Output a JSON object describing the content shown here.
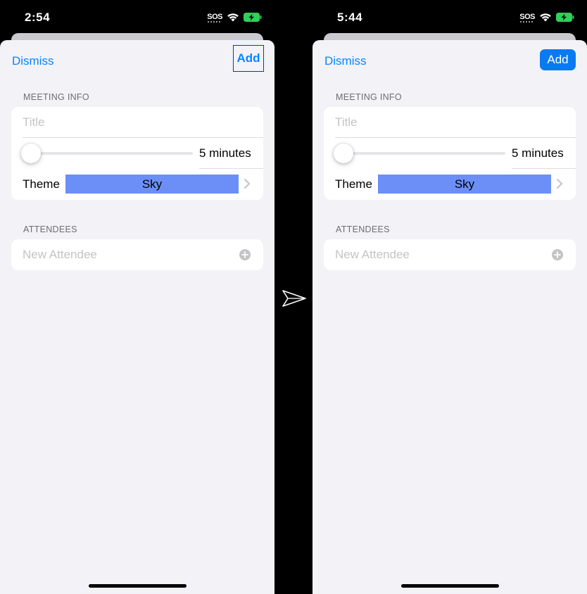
{
  "screens": [
    {
      "status_time": "2:54",
      "sos": "SOS",
      "nav": {
        "dismiss_label": "Dismiss",
        "add_label": "Add"
      },
      "meeting_info": {
        "header": "MEETING INFO",
        "title_placeholder": "Title",
        "slider_value": 0,
        "minutes_label": "5 minutes",
        "theme_label": "Theme",
        "theme_value": "Sky"
      },
      "attendees": {
        "header": "ATTENDEES",
        "placeholder": "New Attendee"
      }
    },
    {
      "status_time": "5:44",
      "sos": "SOS",
      "nav": {
        "dismiss_label": "Dismiss",
        "add_label": "Add"
      },
      "meeting_info": {
        "header": "MEETING INFO",
        "title_placeholder": "Title",
        "slider_value": 0,
        "minutes_label": "5 minutes",
        "theme_label": "Theme",
        "theme_value": "Sky"
      },
      "attendees": {
        "header": "ATTENDEES",
        "placeholder": "New Attendee"
      }
    }
  ],
  "icons": {
    "signal": "sos-signal-icon",
    "wifi": "wifi-icon",
    "battery": "battery-charging-icon",
    "chevron": "chevron-right-icon",
    "add_attendee": "plus-circle-icon",
    "transition": "arrow-right-icon"
  },
  "colors": {
    "accent": "#0a84ff",
    "add_button_filled": "#0a7af0",
    "add_button_highlight_border": "#1a33a6",
    "theme_sky": "#6b8ff7",
    "background": "#f2f2f7",
    "battery_green": "#30d158"
  }
}
